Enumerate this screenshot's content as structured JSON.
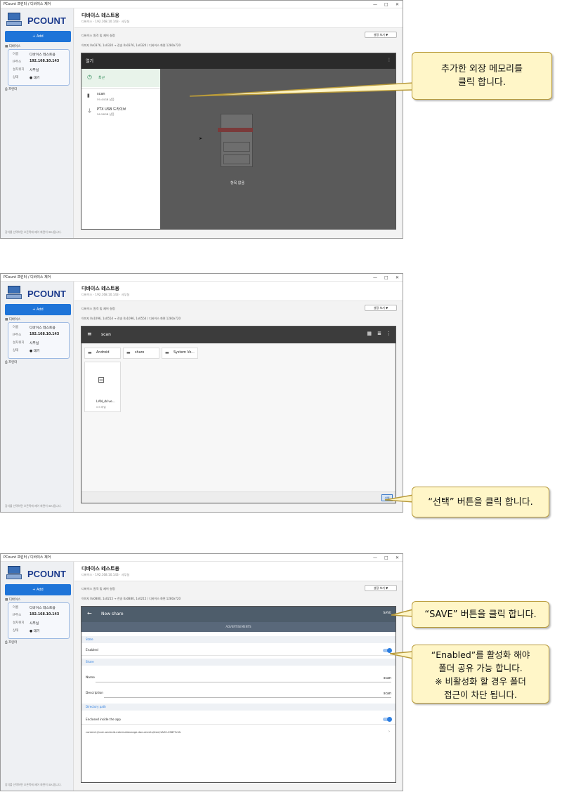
{
  "app": {
    "title": "PCount 프린터 / 디바이스 제어",
    "brand": "PCOUNT",
    "add_label": "+ Add",
    "devices_label": "디바이스",
    "printer_label": "프린터",
    "device": {
      "name_label": "이름",
      "name_value": "디바이스 테스트용",
      "address_label": "IP주소",
      "address_value": "192.168.10.143",
      "location_label": "설치위치",
      "location_value": "사무실",
      "status_label": "상태",
      "status_value": "● 대기"
    },
    "sidebar_footer": "장치를 선택하면 오른쪽에 제어 화면이 표시됩니다.",
    "header_title": "디바이스 테스트용",
    "header_sub": "디바이스 · 192.168.10.143 · 사무실",
    "control_label": "디바이스 원격 및 제어 설정",
    "settings_button": "설정 보기 ▼"
  },
  "panels": [
    {
      "resolution_text": "이미지 0x0376, 1x0320 → 전송 0x0376, 1x0320 / 디바이스 화면 1280x720",
      "drawer_title": "열기",
      "recent_label": "최근",
      "drive1_name": "scan",
      "drive1_sub": "59.44GB 남음",
      "drive2_name": "PTX USB 드라이브",
      "drive2_sub": "56.56GB 남음",
      "empty_label": "항목 없음",
      "callout": "추가한 외장 메모리를\n클릭 합니다."
    },
    {
      "resolution_text": "이미지 0x1096, 1x0554 → 전송 0x1096, 1x0554 / 디바이스 화면 1280x720",
      "toolbar_title": "scan",
      "folders": [
        "Android",
        "share",
        "System Vo..."
      ],
      "file_name": "LAN_drive...",
      "file_size": "0 B 파일",
      "select_button": "선택",
      "callout": "“선택” 버튼을 클릭 합니다."
    },
    {
      "resolution_text": "이미지 0x0880, 1x0215 → 전송 0x0880, 1x0215 / 디바이스 화면 1280x720",
      "toolbar_title": "New share",
      "save_button": "SAVE",
      "advertisements_label": "ADVERTISEMENTS",
      "state_section": "State",
      "enabled_label": "Enabled",
      "share_section": "Share",
      "name_label": "Name",
      "name_value": "scan",
      "description_label": "Description",
      "description_value": "scan",
      "directory_section": "Directory path",
      "enclosed_label": "Enclosed inside the app",
      "path_value": "content://com.android.externalstorage.documents/tree/1AE0-098F%3A",
      "callout_save": "“SAVE” 버튼을 클릭 합니다.",
      "callout_enabled": "“Enabled”를 활성화 해야\n폴더 공유 가능 합니다.\n※ 비활성화 할 경우 폴더\n접근이 차단 됩니다."
    }
  ],
  "colors": {
    "accent": "#1e74d8",
    "toolbar_dark": "#4e5d6b",
    "callout_bg": "#fff6c8",
    "callout_border": "#b89a3a",
    "toggle_on": "#2a7de1"
  }
}
